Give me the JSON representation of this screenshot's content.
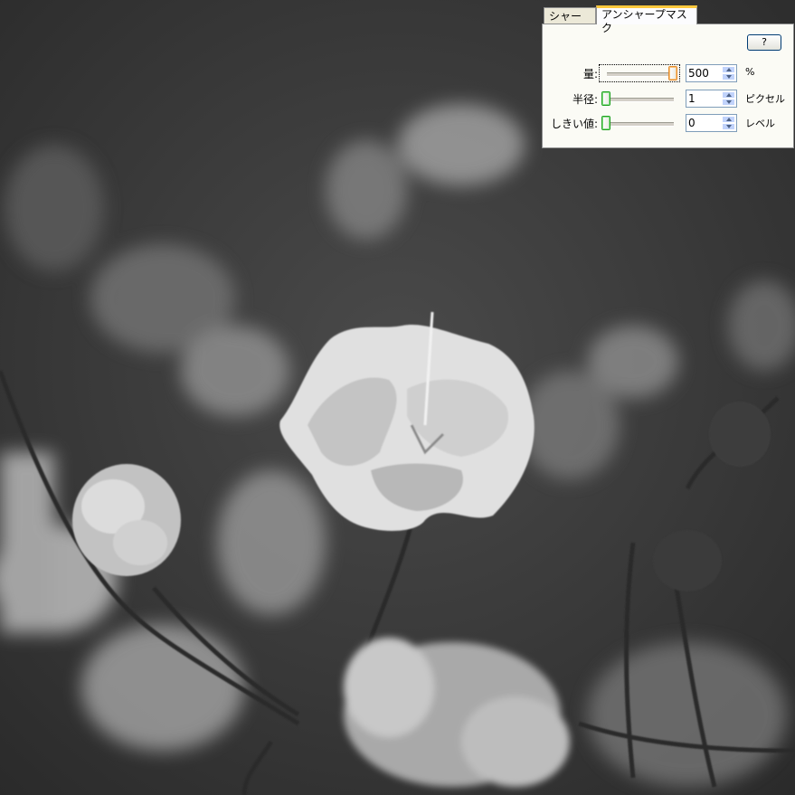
{
  "tabs": [
    {
      "label": "シャープ",
      "active": false
    },
    {
      "label": "アンシャープマスク",
      "active": true
    }
  ],
  "help_button": "?",
  "settings": [
    {
      "label": "量:",
      "value": "500",
      "unit": "%",
      "slider_level": 1.0
    },
    {
      "label": "半径:",
      "value": "1",
      "unit": "ピクセル",
      "slider_level": 0.0
    },
    {
      "label": "しきい値:",
      "value": "0",
      "unit": "レベル",
      "slider_level": 0.0
    }
  ],
  "photo": {
    "subject": "grayscale-flower-photo"
  }
}
